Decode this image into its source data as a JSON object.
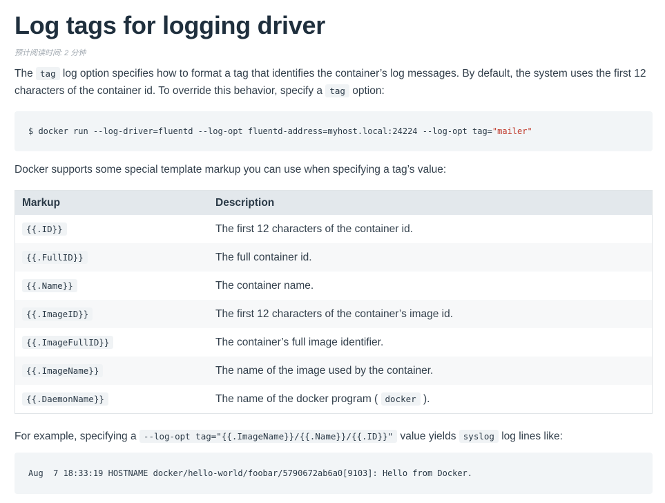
{
  "title": "Log tags for logging driver",
  "reading_time": "预计阅读时间: 2 分钟",
  "intro": {
    "t1": "The ",
    "code1": "tag",
    "t2": " log option specifies how to format a tag that identifies the container’s log messages. By default, the system uses the first 12 characters of the container id. To override this behavior, specify a ",
    "code2": "tag",
    "t3": " option:"
  },
  "code_example_1": {
    "command": "$ docker run --log-driver=fluentd --log-opt fluentd-address=myhost.local:24224 --log-opt tag=",
    "string": "\"mailer\""
  },
  "support_text": "Docker supports some special template markup you can use when specifying a tag’s value:",
  "table": {
    "headers": [
      "Markup",
      "Description"
    ],
    "rows": [
      {
        "markup": "{{.ID}}",
        "description": "The first 12 characters of the container id."
      },
      {
        "markup": "{{.FullID}}",
        "description": "The full container id."
      },
      {
        "markup": "{{.Name}}",
        "description": "The container name."
      },
      {
        "markup": "{{.ImageID}}",
        "description": "The first 12 characters of the container’s image id."
      },
      {
        "markup": "{{.ImageFullID}}",
        "description": "The container’s full image identifier."
      },
      {
        "markup": "{{.ImageName}}",
        "description": "The name of the image used by the container."
      },
      {
        "markup": "{{.DaemonName}}",
        "description_pre": "The name of the docker program (",
        "description_code": "docker",
        "description_post": ")."
      }
    ]
  },
  "example": {
    "t1": "For example, specifying a ",
    "code1": "--log-opt tag=\"{{.ImageName}}/{{.Name}}/{{.ID}}\"",
    "t2": " value yields ",
    "code2": "syslog",
    "t3": " log lines like:"
  },
  "code_example_2": "Aug  7 18:33:19 HOSTNAME docker/hello-world/foobar/5790672ab6a0[9103]: Hello from Docker."
}
